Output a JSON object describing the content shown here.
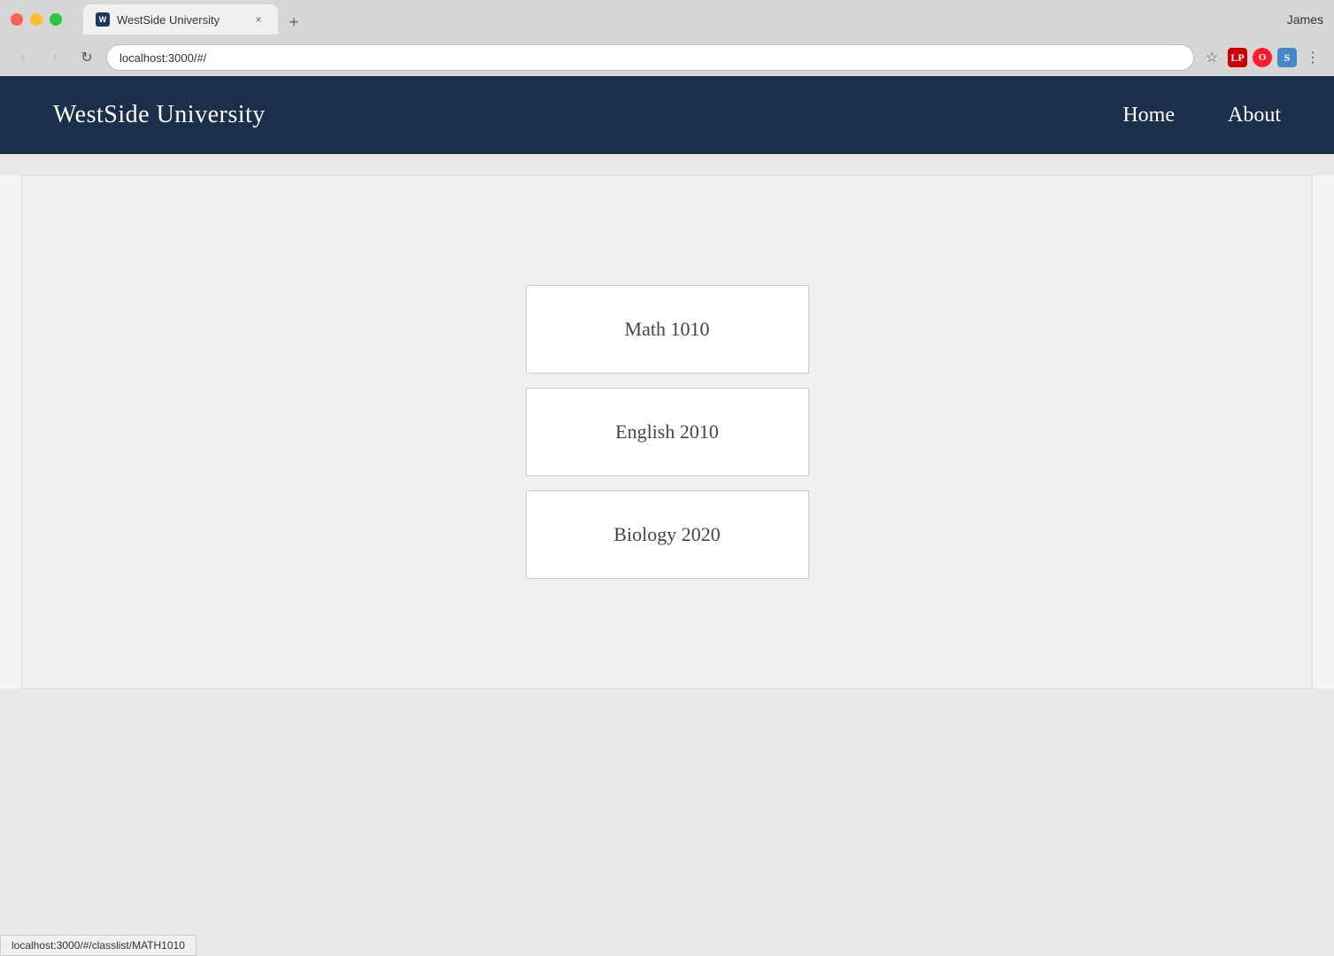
{
  "browser": {
    "tab_title": "WestSide University",
    "tab_favicon_label": "W",
    "address": "localhost:3000/#/",
    "user_name": "James",
    "new_tab_label": "+",
    "back_button": "‹",
    "forward_button": "›",
    "reload_button": "↻",
    "star_icon": "☆",
    "menu_icon": "⋮",
    "tab_close": "×",
    "lastpass_label": "LP",
    "opera_label": "O",
    "stylus_label": "S"
  },
  "site": {
    "logo": "WestSide University",
    "nav_home": "Home",
    "nav_about": "About"
  },
  "courses": [
    {
      "id": "MATH1010",
      "title": "Math 1010",
      "url": "localhost:3000/#/classlist/MATH1010"
    },
    {
      "id": "ENGLISH2010",
      "title": "English 2010",
      "url": "localhost:3000/#/classlist/ENGLISH2010"
    },
    {
      "id": "BIOLOGY2020",
      "title": "Biology 2020",
      "url": "localhost:3000/#/classlist/BIOLOGY2020"
    }
  ],
  "status_bar": {
    "url": "localhost:3000/#/classlist/MATH1010"
  }
}
